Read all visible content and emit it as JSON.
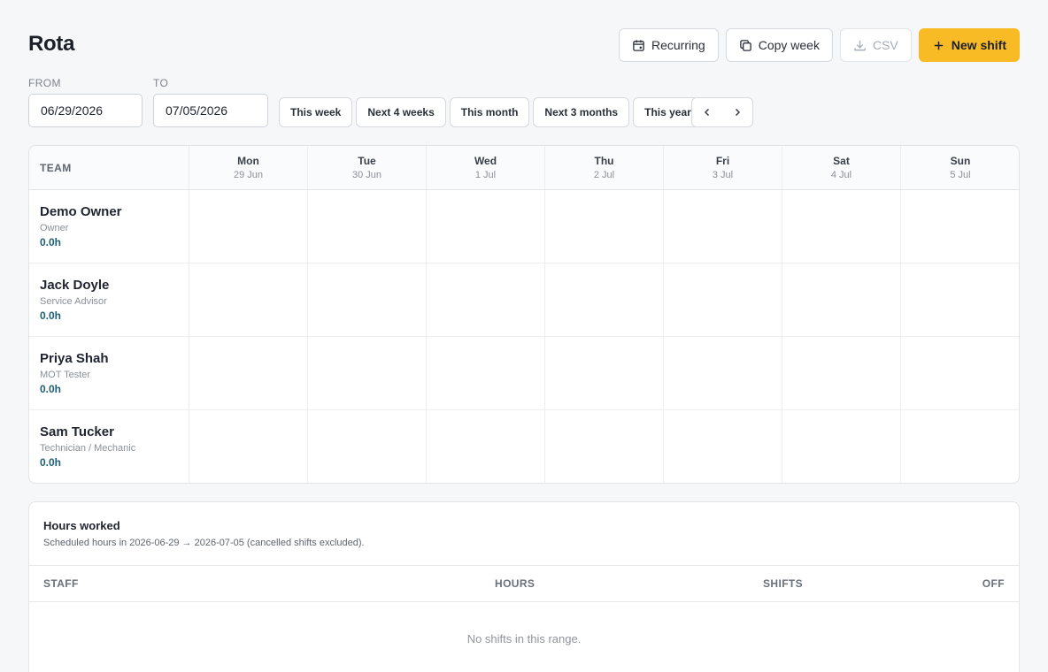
{
  "page": {
    "title": "Rota"
  },
  "actions": {
    "recurring": "Recurring",
    "copy_week": "Copy week",
    "csv": "CSV",
    "new_shift": "New shift"
  },
  "filters": {
    "from_label": "FROM",
    "from_value": "06/29/2026",
    "to_label": "TO",
    "to_value": "07/05/2026",
    "ranges": [
      "This week",
      "Next 4 weeks",
      "This month",
      "Next 3 months",
      "This year"
    ]
  },
  "rota": {
    "team_header": "TEAM",
    "days": [
      {
        "name": "Mon",
        "date": "29 Jun"
      },
      {
        "name": "Tue",
        "date": "30 Jun"
      },
      {
        "name": "Wed",
        "date": "1 Jul"
      },
      {
        "name": "Thu",
        "date": "2 Jul"
      },
      {
        "name": "Fri",
        "date": "3 Jul"
      },
      {
        "name": "Sat",
        "date": "4 Jul"
      },
      {
        "name": "Sun",
        "date": "5 Jul"
      }
    ],
    "members": [
      {
        "name": "Demo Owner",
        "role": "Owner",
        "hours": "0.0h"
      },
      {
        "name": "Jack Doyle",
        "role": "Service Advisor",
        "hours": "0.0h"
      },
      {
        "name": "Priya Shah",
        "role": "MOT Tester",
        "hours": "0.0h"
      },
      {
        "name": "Sam Tucker",
        "role": "Technician / Mechanic",
        "hours": "0.0h"
      }
    ]
  },
  "hours_worked": {
    "title": "Hours worked",
    "subtitle": "Scheduled hours in 2026-06-29 → 2026-07-05 (cancelled shifts excluded).",
    "columns": {
      "staff": "STAFF",
      "hours": "HOURS",
      "shifts": "SHIFTS",
      "off": "OFF"
    },
    "empty_message": "No shifts in this range."
  },
  "colors": {
    "accent": "#f8bb25",
    "hours_text": "#1d5f74"
  }
}
